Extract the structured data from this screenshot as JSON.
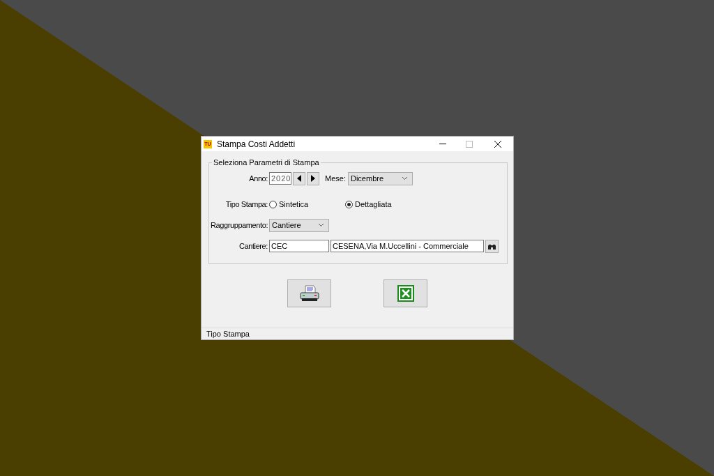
{
  "window": {
    "title": "Stampa Costi Addetti",
    "app_icon_text": "TU"
  },
  "group": {
    "legend": "Seleziona Parametri di Stampa"
  },
  "anno": {
    "label": "Anno:",
    "value": "2020"
  },
  "mese": {
    "label": "Mese:",
    "value": "Dicembre"
  },
  "tipo_stampa": {
    "label": "Tipo Stampa:",
    "options": [
      {
        "label": "Sintetica",
        "selected": false
      },
      {
        "label": "Dettagliata",
        "selected": true
      }
    ]
  },
  "raggruppamento": {
    "label": "Raggruppamento:",
    "value": "Cantiere"
  },
  "cantiere": {
    "label": "Cantiere:",
    "code": "CEC",
    "description": "CESENA,Via M.Uccellini - Commerciale"
  },
  "status_bar": "Tipo Stampa"
}
